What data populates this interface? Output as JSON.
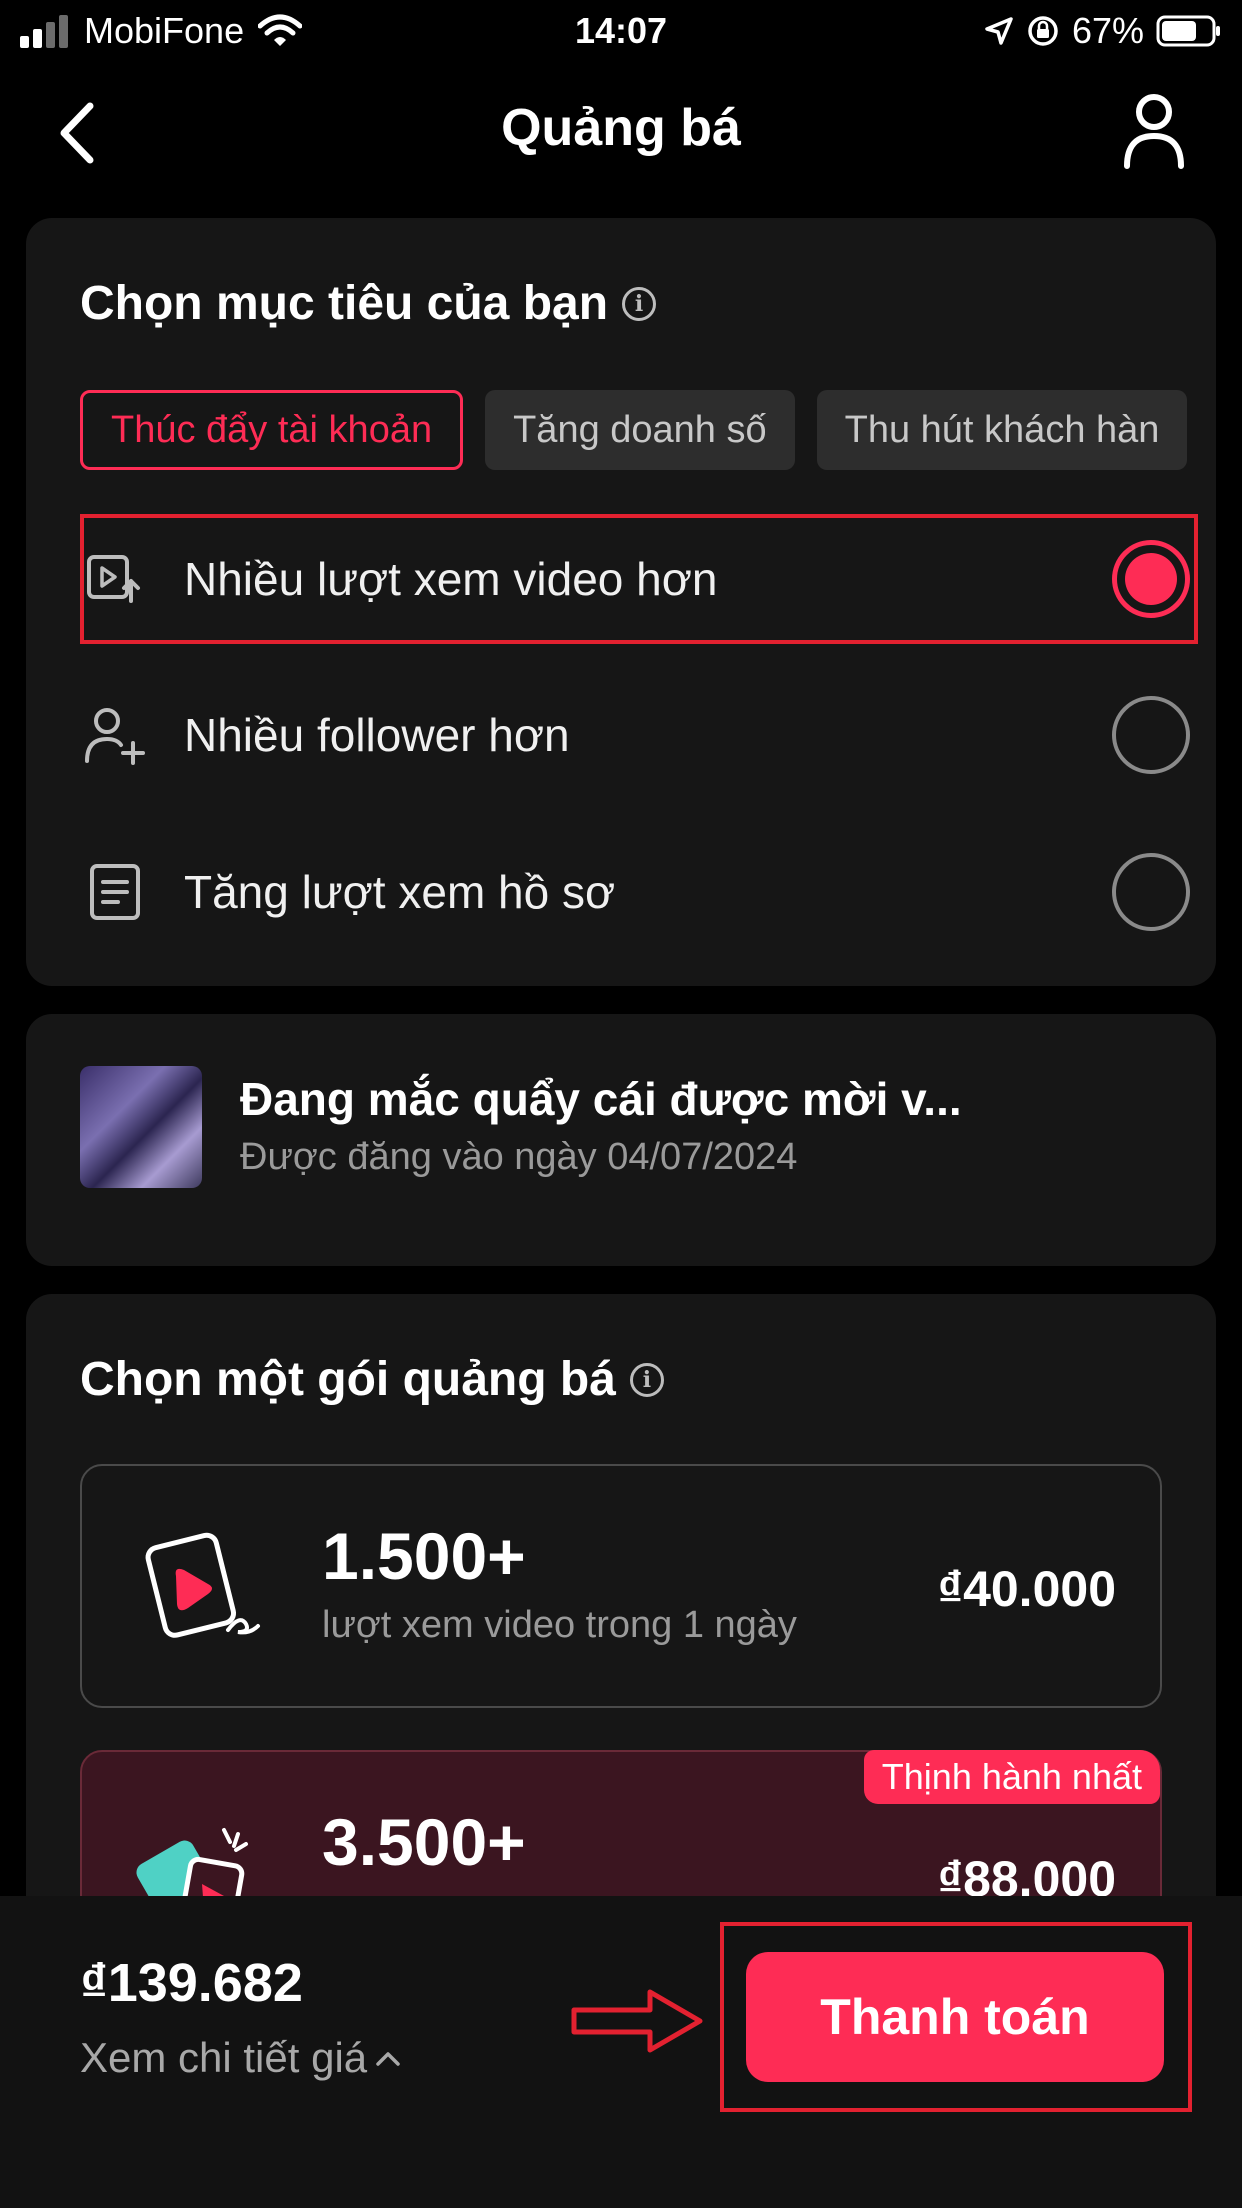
{
  "status_bar": {
    "carrier": "MobiFone",
    "time": "14:07",
    "battery_percent": "67%"
  },
  "nav": {
    "title": "Quảng bá"
  },
  "goal_section": {
    "title": "Chọn mục tiêu của bạn",
    "chips": [
      {
        "label": "Thúc đẩy tài khoản",
        "active": true
      },
      {
        "label": "Tăng doanh số",
        "active": false
      },
      {
        "label": "Thu hút khách hàn",
        "active": false
      }
    ],
    "options": [
      {
        "label": "Nhiều lượt xem video hơn",
        "icon": "video-views-icon",
        "selected": true
      },
      {
        "label": "Nhiều follower hơn",
        "icon": "add-follower-icon",
        "selected": false
      },
      {
        "label": "Tăng lượt xem hồ sơ",
        "icon": "profile-doc-icon",
        "selected": false
      }
    ]
  },
  "video": {
    "title": "Đang mắc quẩy cái được mời v...",
    "posted": "Được đăng vào ngày 04/07/2024"
  },
  "package_section": {
    "title": "Chọn một gói quảng bá",
    "packages": [
      {
        "count": "1.500+",
        "description": "lượt xem video trong 1 ngày",
        "price": "₫40.000",
        "badge": ""
      },
      {
        "count": "3.500+",
        "description": "",
        "price": "₫88.000",
        "badge": "Thịnh hành nhất"
      }
    ]
  },
  "bottom_bar": {
    "total": "₫139.682",
    "details_label": "Xem chi tiết giá",
    "pay_label": "Thanh toán"
  },
  "colors": {
    "accent": "#fe2c55",
    "annotation_red": "#e32130",
    "card_bg": "#161616"
  }
}
